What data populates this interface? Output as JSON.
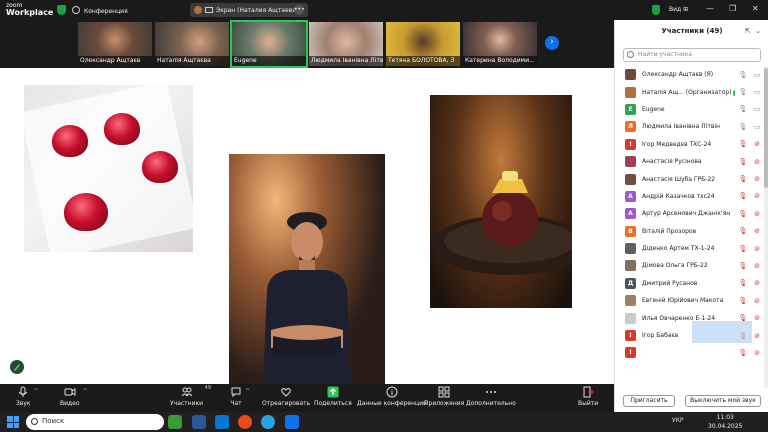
{
  "app": {
    "logo_line1": "zoom",
    "logo_line2": "Workplace",
    "conference_label": "Конференция"
  },
  "share_pill": {
    "label": "Экран (Наталия Ащтаева)",
    "more": "•••"
  },
  "view_label": "Вид",
  "window_controls": {
    "minimize": "—",
    "maximize": "❐",
    "close": "✕"
  },
  "thumbnails": [
    {
      "name": "Олександр Ащтаєв",
      "color": "#6a4a3a"
    },
    {
      "name": "Наталія Ащтаєва",
      "color": "#7a6250"
    },
    {
      "name": "Eugene",
      "color": "#4a5a4a"
    },
    {
      "name": "Людмила Іванівна Лiтвiн",
      "color": "#8a7060"
    },
    {
      "name": "Тетяна БОЛОТОВА, З",
      "color": "#c89a30"
    },
    {
      "name": "Катерина Володими...",
      "color": "#3a3a40"
    }
  ],
  "strip_next": "›",
  "toolbar": {
    "audio": "Звук",
    "video": "Видео",
    "participants": "Участники",
    "participants_count": "49",
    "chat": "Чат",
    "react": "Отреагировать",
    "share": "Поделиться",
    "info": "Данные конференции",
    "apps": "Приложения",
    "more": "Дополнительно",
    "leave": "Выйти"
  },
  "panel": {
    "title": "Участники (49)",
    "search_placeholder": "Найти участника",
    "host_badge": "🔊",
    "invite": "Пригласить",
    "mute_all": "Выключить мой звук",
    "participants": [
      {
        "name": "Олександр Ащтаєв (Я)",
        "initial": "",
        "color": "#6a4a3a",
        "mic": "on",
        "cam": "on"
      },
      {
        "name": "Наталія Ащ... (Организатор)",
        "initial": "",
        "color": "#b07040",
        "mic": "host",
        "cam": "on"
      },
      {
        "name": "Eugene",
        "initial": "E",
        "color": "#2ea44f",
        "mic": "on",
        "cam": "on"
      },
      {
        "name": "Людмила Іванівна Лiтвiн",
        "initial": "Л",
        "color": "#e8712a",
        "mic": "on",
        "cam": "on"
      },
      {
        "name": "Ігор Медведєв ТХС-24",
        "initial": "І",
        "color": "#d83a2a",
        "mic": "off",
        "cam": "off"
      },
      {
        "name": "Анастасія Русінова",
        "initial": "",
        "color": "#a04050",
        "mic": "off",
        "cam": "off"
      },
      {
        "name": "Анастасія Шуба ГРБ-22",
        "initial": "",
        "color": "#705040",
        "mic": "off",
        "cam": "off"
      },
      {
        "name": "Андрій Казачков тхс24",
        "initial": "А",
        "color": "#9b59d0",
        "mic": "off",
        "cam": "off"
      },
      {
        "name": "Артур Арсенович Джанік'ян",
        "initial": "А",
        "color": "#9b59d0",
        "mic": "off",
        "cam": "off"
      },
      {
        "name": "Віталій Прозоров",
        "initial": "В",
        "color": "#e8712a",
        "mic": "off",
        "cam": "off"
      },
      {
        "name": "Діденко Артем ТХ-1-24",
        "initial": "",
        "color": "#606060",
        "mic": "off",
        "cam": "off"
      },
      {
        "name": "Дімова Ольга ГРБ-22",
        "initial": "",
        "color": "#807060",
        "mic": "off",
        "cam": "off"
      },
      {
        "name": "Дмитрий  Русанов",
        "initial": "Д",
        "color": "#4a5560",
        "mic": "off",
        "cam": "off"
      },
      {
        "name": "Евгеній Юрійович Макота",
        "initial": "",
        "color": "#a08060",
        "mic": "off",
        "cam": "off"
      },
      {
        "name": "Илья Овчаренко Е-1-24",
        "initial": "",
        "color": "#cccccc",
        "mic": "off",
        "cam": "off"
      },
      {
        "name": "Ігор Бабаєв",
        "initial": "І",
        "color": "#d83a2a",
        "mic": "off",
        "cam": "off"
      },
      {
        "name": "",
        "initial": "І",
        "color": "#d83a2a",
        "mic": "off",
        "cam": "off"
      }
    ]
  },
  "taskbar": {
    "search": "Поиск",
    "tray": "УКР",
    "time": "11:03",
    "date": "30.04.2025"
  }
}
